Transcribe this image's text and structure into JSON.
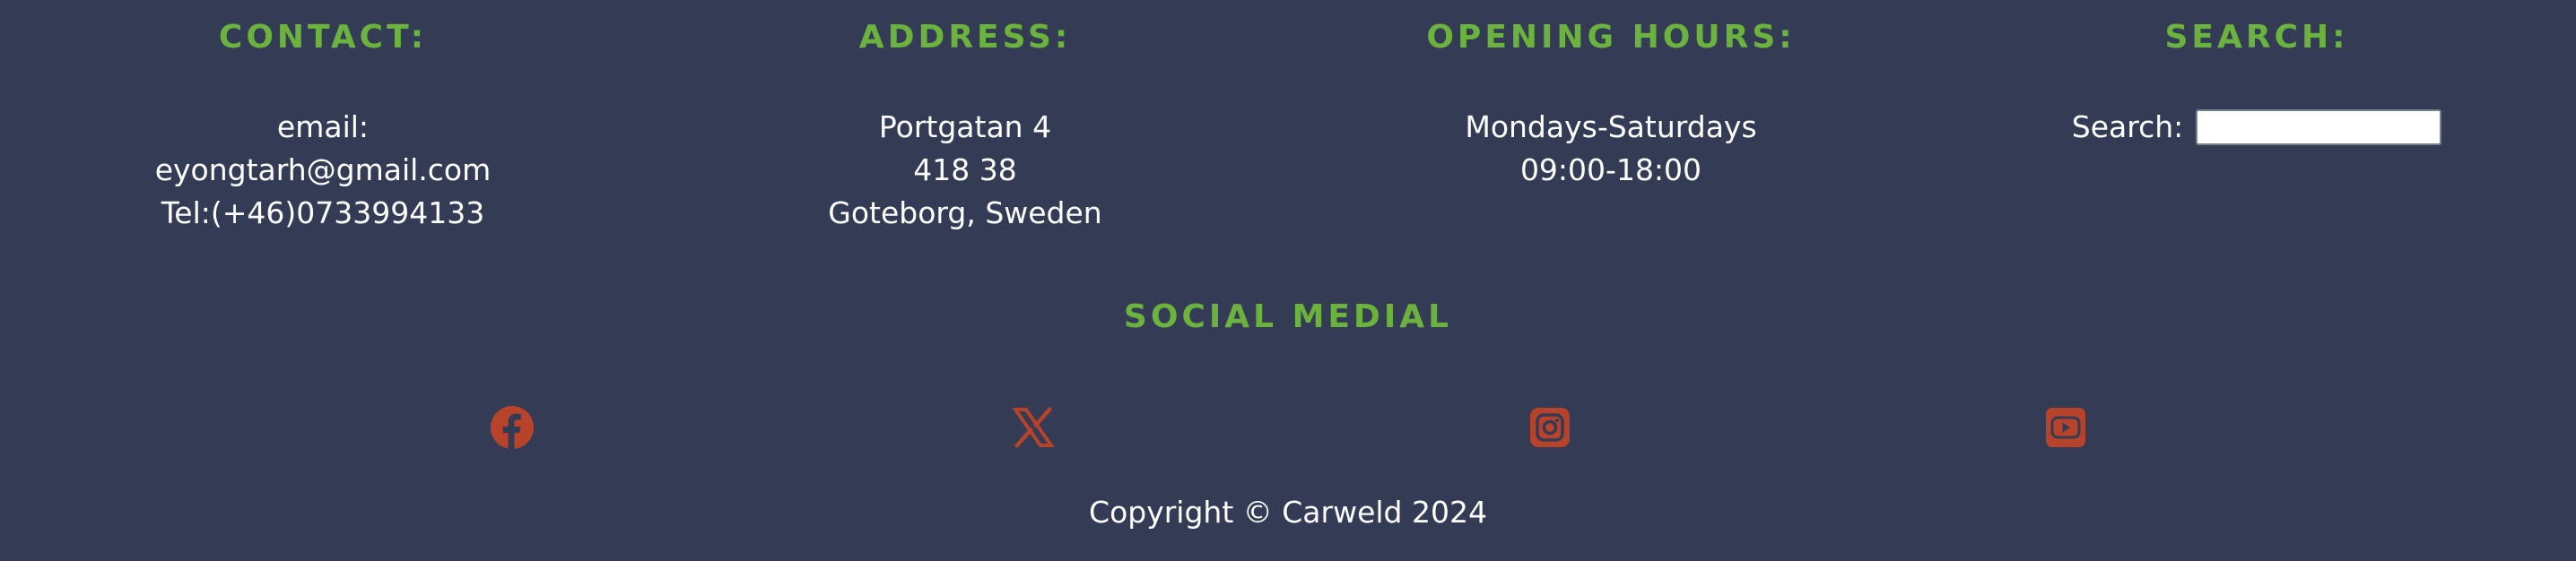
{
  "contact": {
    "heading": "CONTACT:",
    "email_label": "email:",
    "email": "eyongtarh@gmail.com",
    "tel": "Tel:(+46)0733994133"
  },
  "address": {
    "heading": "ADDRESS:",
    "street": "Portgatan 4",
    "postal_code": "418 38",
    "city": "Goteborg, Sweden"
  },
  "opening_hours": {
    "heading": "OPENING HOURS:",
    "days": "Mondays-Saturdays",
    "hours": "09:00-18:00"
  },
  "search": {
    "heading": "SEARCH:",
    "label": "Search:",
    "value": ""
  },
  "social": {
    "heading": "SOCIAL MEDIAL",
    "icon_color": "#b8432b",
    "icons": [
      "facebook-icon",
      "x-icon",
      "instagram-icon",
      "youtube-icon"
    ]
  },
  "copyright": "Copyright © Carweld 2024",
  "colors": {
    "background": "#343b55",
    "heading": "#6bb23f",
    "text": "#ffffff"
  }
}
